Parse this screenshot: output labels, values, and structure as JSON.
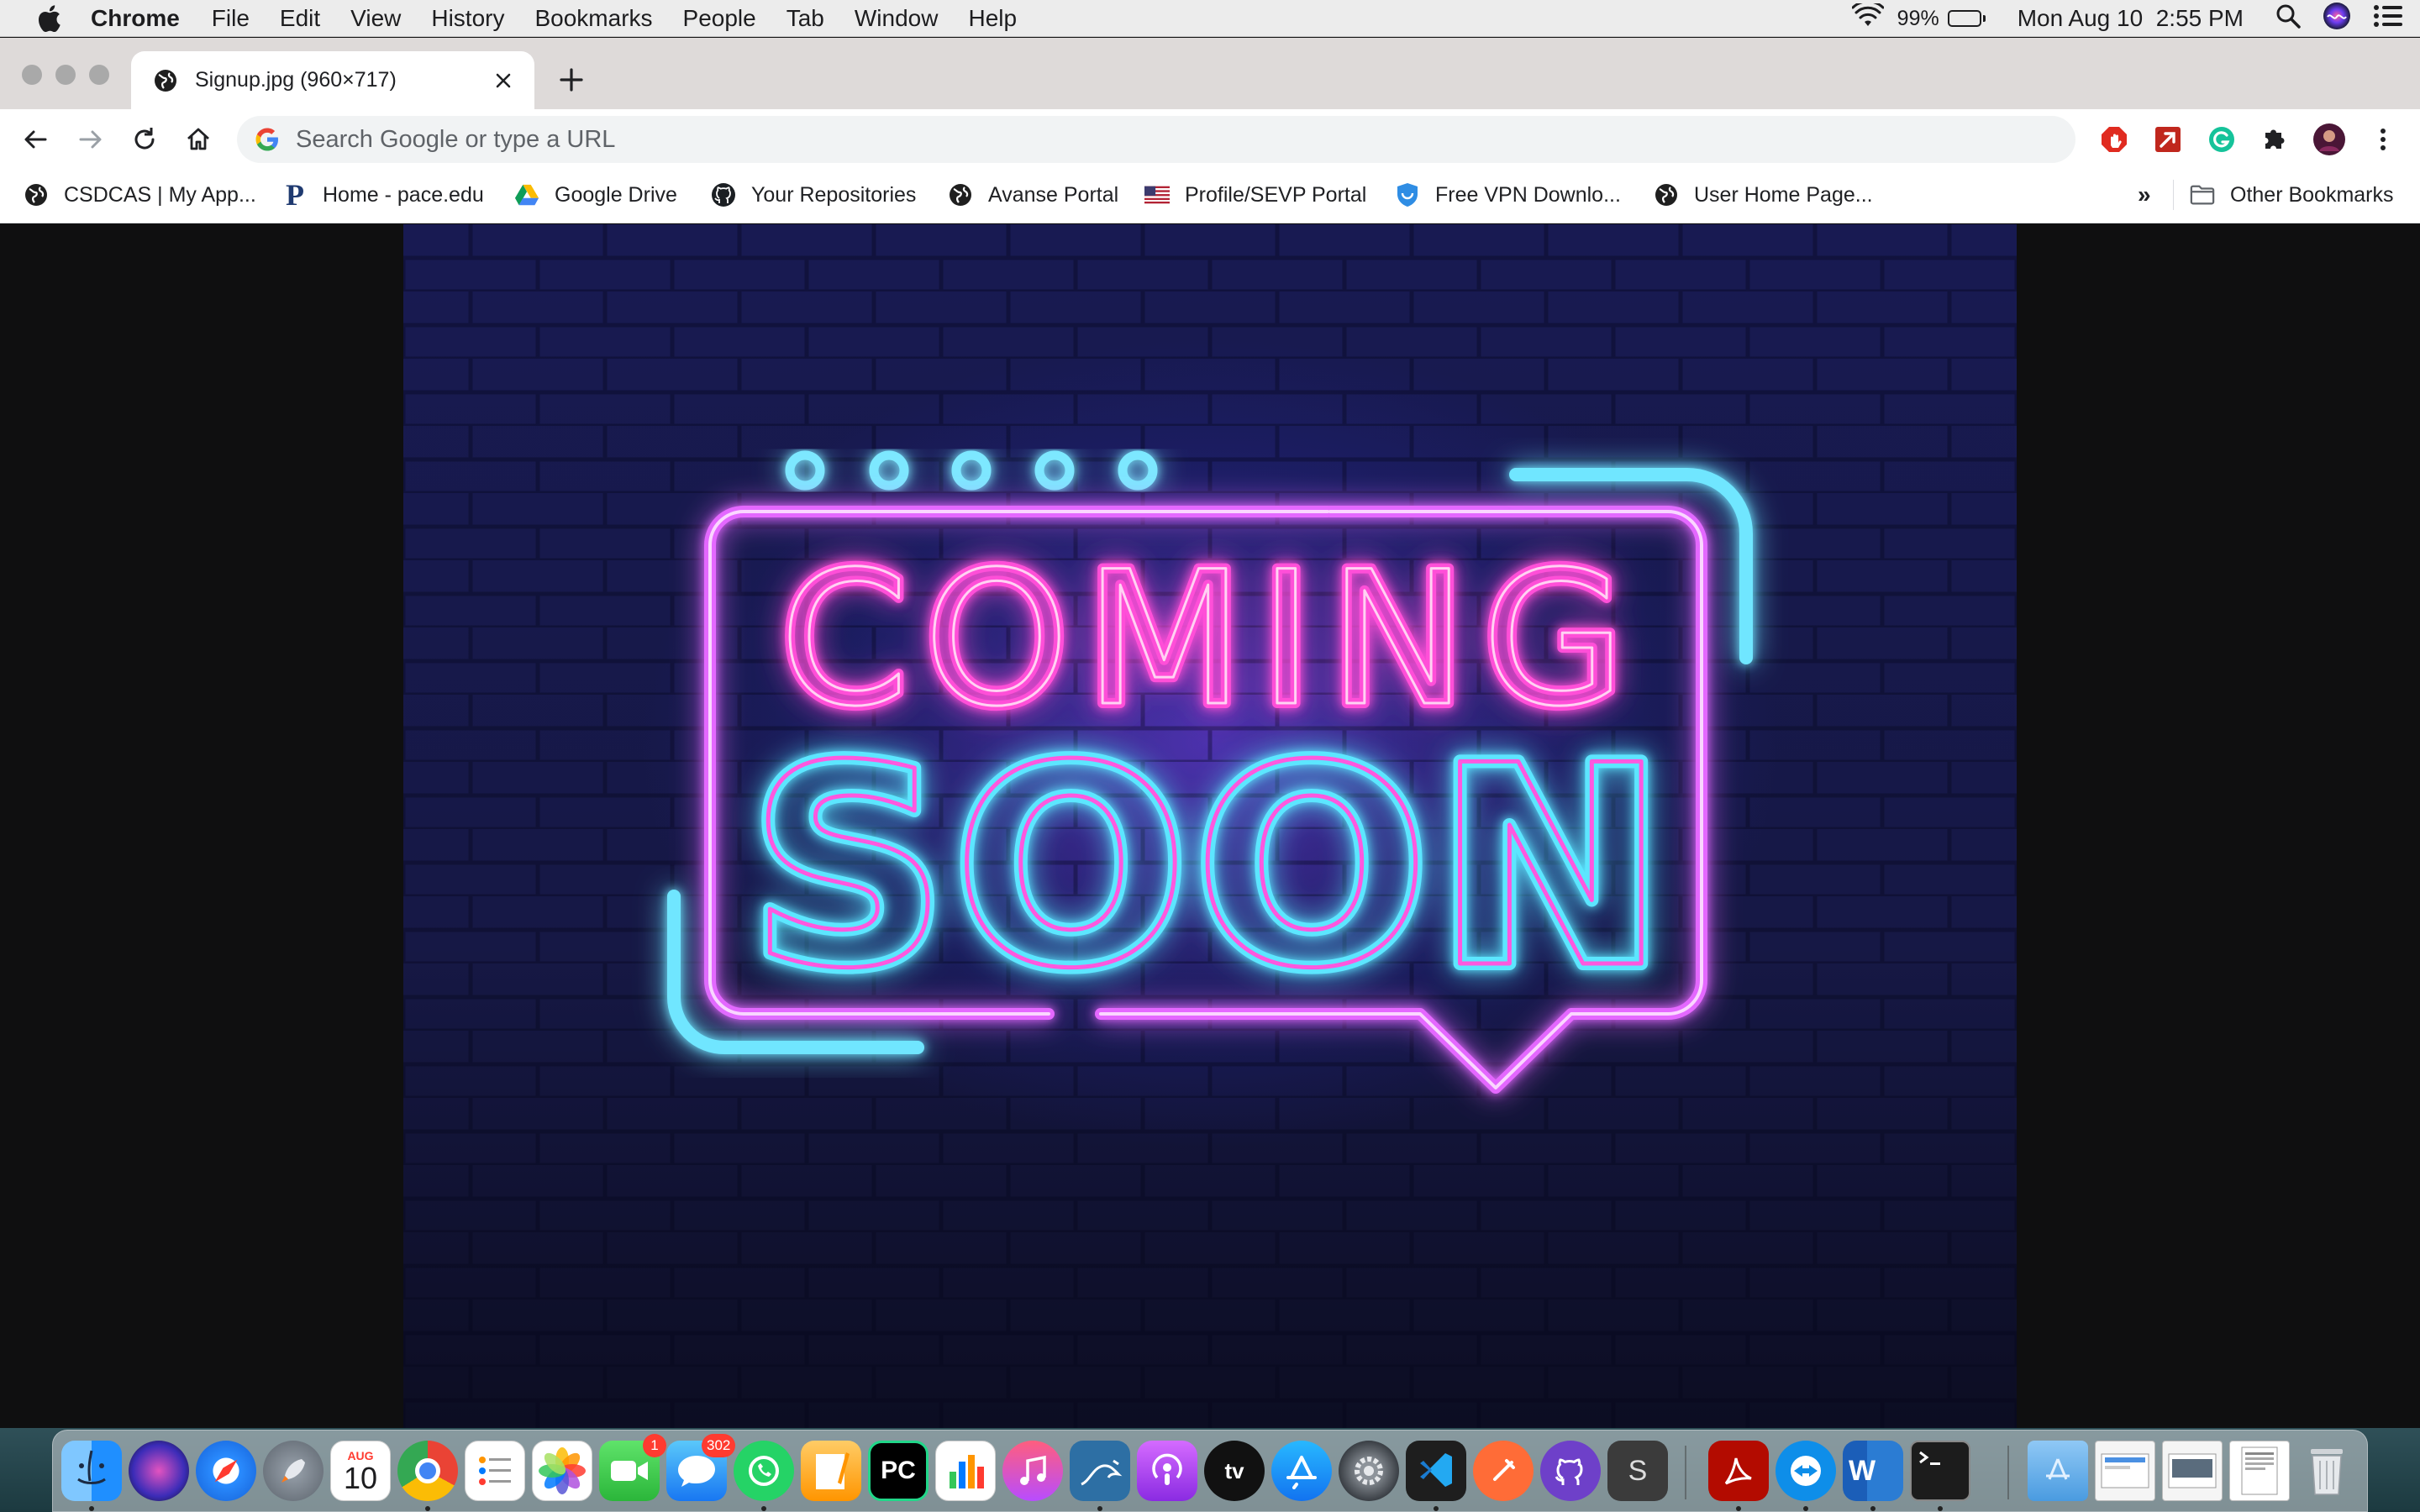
{
  "menubar": {
    "app_name": "Chrome",
    "items": [
      "File",
      "Edit",
      "View",
      "History",
      "Bookmarks",
      "People",
      "Tab",
      "Window",
      "Help"
    ],
    "battery_percent": "99%",
    "battery_level": 0.99,
    "datetime": "Mon Aug 10  2:55 PM"
  },
  "tab": {
    "title": "Signup.jpg (960×717)"
  },
  "omnibox": {
    "placeholder": "Search Google or type a URL"
  },
  "bookmarks": {
    "items": [
      {
        "label": "CSDCAS | My App...",
        "icon": "globe-icon"
      },
      {
        "label": "Home - pace.edu",
        "icon": "pace-p-icon"
      },
      {
        "label": "Google Drive",
        "icon": "google-drive-icon"
      },
      {
        "label": "Your Repositories",
        "icon": "github-icon"
      },
      {
        "label": "Avanse Portal",
        "icon": "globe-icon"
      },
      {
        "label": "Profile/SEVP Portal",
        "icon": "us-flag-icon"
      },
      {
        "label": "Free VPN Downlo...",
        "icon": "shield-icon"
      },
      {
        "label": "User Home Page...",
        "icon": "globe-icon"
      }
    ],
    "overflow": "»",
    "other": "Other Bookmarks"
  },
  "image": {
    "line1": "COMING",
    "line2": "SOON"
  },
  "dock": {
    "calendar_month": "AUG",
    "calendar_day": "10",
    "facetime_badge": "1",
    "messages_badge": "302",
    "pycharm_label": "PC",
    "word_label": "W",
    "appletv_label": "tv",
    "sublime_label": "S"
  },
  "colors": {
    "neon_pink": "#ff4fd8",
    "neon_cyan": "#5ce6ff",
    "neon_purple": "#d050ff",
    "chrome_accent": "#1a73e8"
  }
}
